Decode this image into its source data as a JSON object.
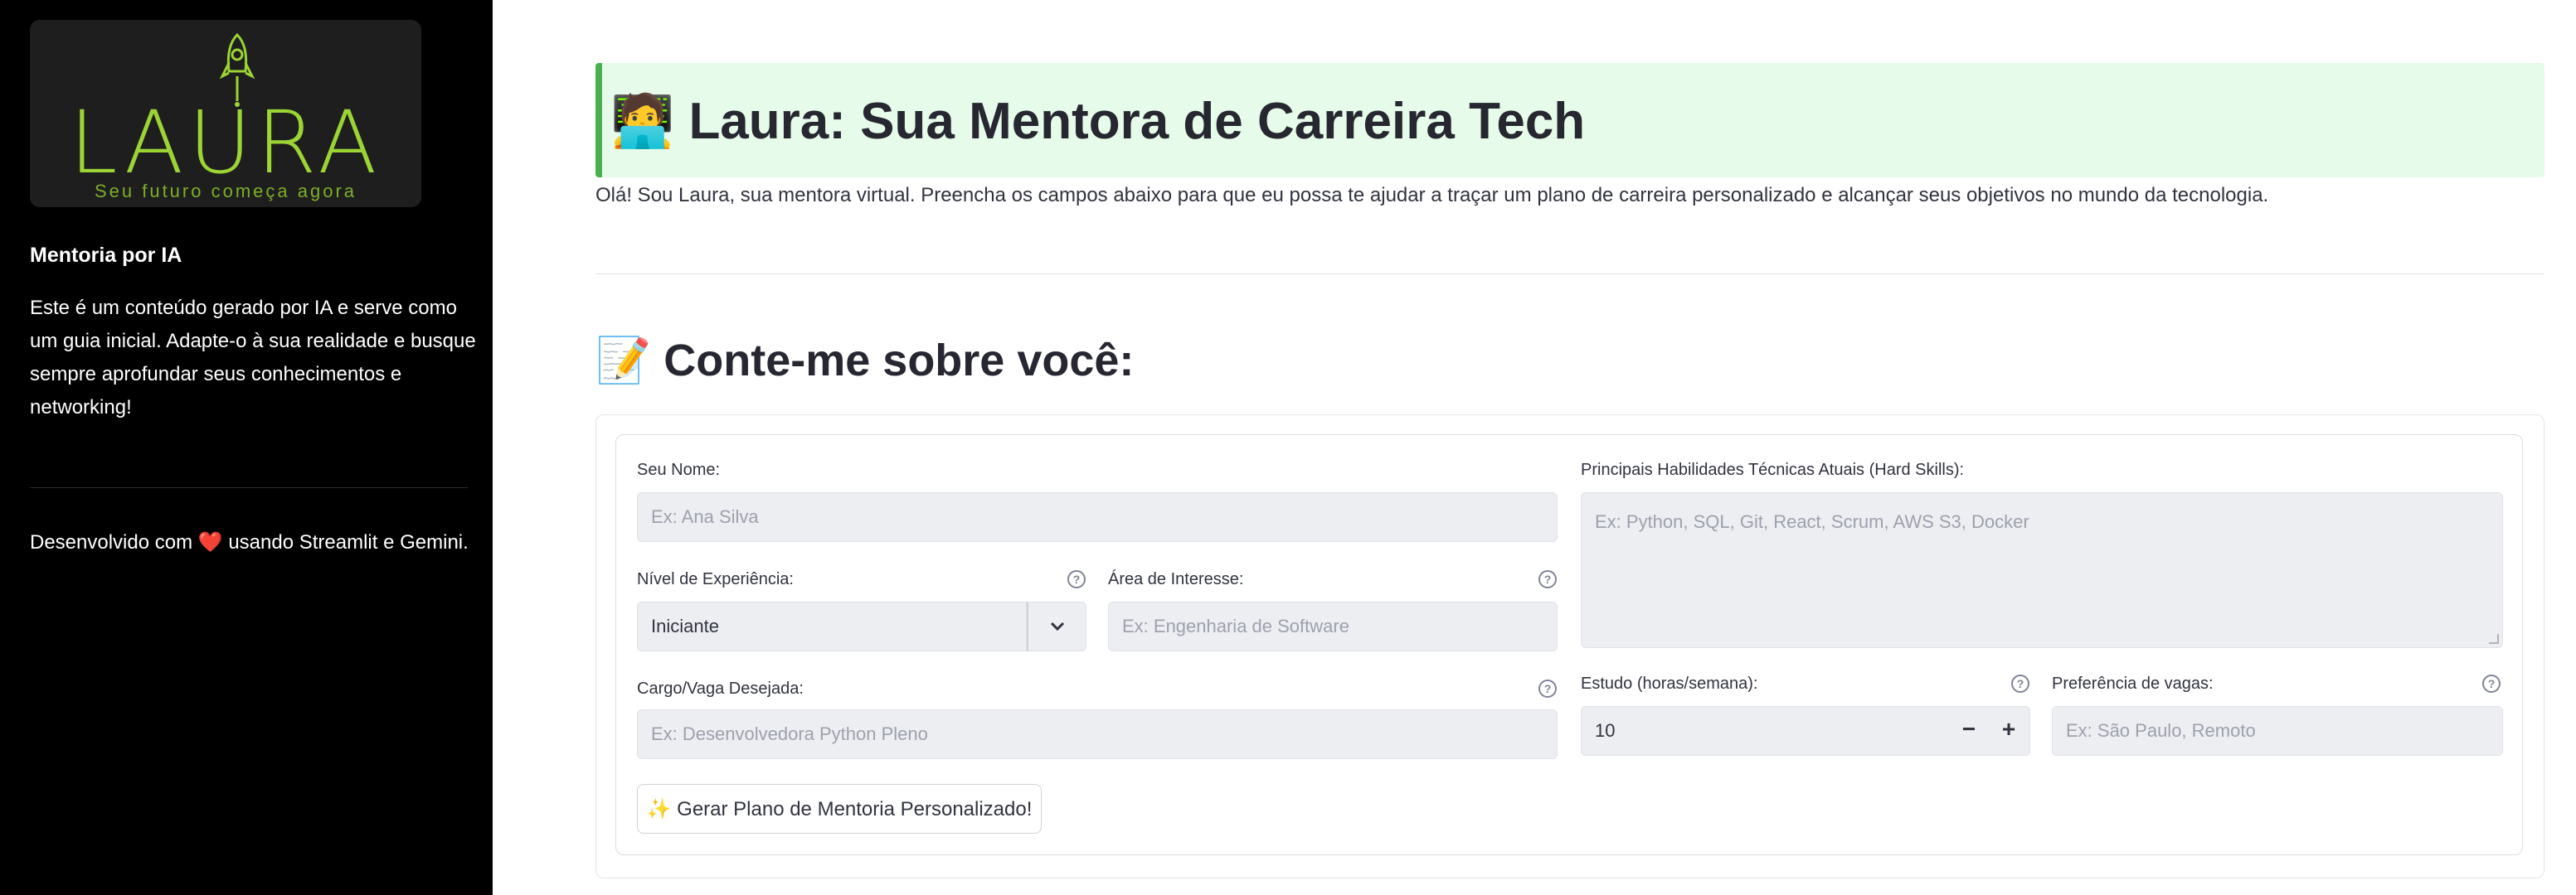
{
  "sidebar": {
    "logo_text": "LAURA",
    "logo_tagline": "Seu futuro começa agora",
    "heading": "Mentoria por IA",
    "disclaimer": "Este é um conteúdo gerado por IA e serve como um guia inicial. Adapte-o à sua realidade e busque sempre aprofundar seus conhecimentos e networking!",
    "footer_prefix": "Desenvolvido com",
    "footer_heart": "❤️",
    "footer_suffix": "usando Streamlit e Gemini."
  },
  "main": {
    "title_emoji": "🧑‍💻",
    "title": "Laura: Sua Mentora de Carreira Tech",
    "intro": "Olá! Sou Laura, sua mentora virtual. Preencha os campos abaixo para que eu possa te ajudar a traçar um plano de carreira personalizado e alcançar seus objetivos no mundo da tecnologia.",
    "section_emoji": "📝",
    "section_title": "Conte-me sobre você:"
  },
  "form": {
    "name": {
      "label": "Seu Nome:",
      "placeholder": "Ex: Ana Silva"
    },
    "experience": {
      "label": "Nível de Experiência:",
      "value": "Iniciante"
    },
    "interest": {
      "label": "Área de Interesse:",
      "placeholder": "Ex: Engenharia de Software"
    },
    "target_role": {
      "label": "Cargo/Vaga Desejada:",
      "placeholder": "Ex: Desenvolvedora Python Pleno"
    },
    "hard_skills": {
      "label": "Principais Habilidades Técnicas Atuais (Hard Skills):",
      "placeholder": "Ex: Python, SQL, Git, React, Scrum, AWS S3, Docker"
    },
    "study_hours": {
      "label": "Estudo (horas/semana):",
      "value": "10",
      "minus": "−",
      "plus": "+"
    },
    "job_pref": {
      "label": "Preferência de vagas:",
      "placeholder": "Ex: São Paulo, Remoto"
    },
    "help_glyph": "?",
    "submit_label": "✨ Gerar Plano de Mentoria Personalizado!"
  },
  "colors": {
    "sidebar_bg": "#000000",
    "logo_green": "#9bd434",
    "title_bg": "#e6fbe9",
    "title_border": "#4caf50",
    "input_bg": "#eceef2"
  },
  "icons": [
    "rocket-icon",
    "help-icon",
    "chevron-down-icon",
    "minus-icon",
    "plus-icon",
    "sparkles-icon"
  ]
}
